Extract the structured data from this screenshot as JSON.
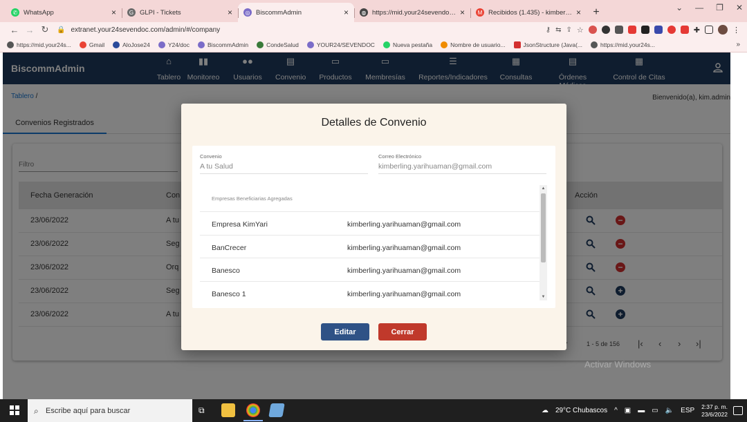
{
  "browser": {
    "tabs": [
      {
        "title": "WhatsApp",
        "color": "#25d366"
      },
      {
        "title": "GLPI - Tickets",
        "color": "#6b6b6b"
      },
      {
        "title": "BiscommAdmin",
        "color": "#7b6cc8"
      },
      {
        "title": "https://mid.your24sevendoc.com",
        "color": "#444444"
      },
      {
        "title": "Recibidos (1.435) - kimberlingyar",
        "color": "#ea4335"
      }
    ],
    "new_tab": "+",
    "url": "extranet.your24sevendoc.com/admin/#/company",
    "bookmarks": [
      {
        "label": "https://mid.your24s...",
        "color": "#555555"
      },
      {
        "label": "Gmail",
        "color": "#ea4335"
      },
      {
        "label": "AloJose24",
        "color": "#2b4a9a"
      },
      {
        "label": "Y24/doc",
        "color": "#7b6cc8"
      },
      {
        "label": "BiscommAdmin",
        "color": "#7b6cc8"
      },
      {
        "label": "CondeSalud",
        "color": "#3a7a3a"
      },
      {
        "label": "YOUR24/SEVENDOC",
        "color": "#7b6cc8"
      },
      {
        "label": "Nueva pestaña",
        "color": "#25d366"
      },
      {
        "label": "Nombre de usuario...",
        "color": "#f08c00"
      },
      {
        "label": "JsonStructure (Java(...",
        "color": "#d32f2f"
      },
      {
        "label": "https://mid.your24s...",
        "color": "#555555"
      }
    ],
    "bookmarks_more": "»"
  },
  "app": {
    "brand": "BiscommAdmin",
    "nav": [
      {
        "label": "Tablero",
        "icon": "home-icon",
        "glyph": "⌂"
      },
      {
        "label": "Monitoreo",
        "icon": "bar-chart-icon",
        "glyph": "▮"
      },
      {
        "label": "Usuarios",
        "icon": "users-icon",
        "glyph": "👥"
      },
      {
        "label": "Convenio",
        "icon": "store-icon",
        "glyph": "▤"
      },
      {
        "label": "Productos",
        "icon": "card-icon",
        "glyph": "▭"
      },
      {
        "label": "Membresías",
        "icon": "card-icon",
        "glyph": "▭"
      },
      {
        "label": "Reportes/Indicadores",
        "icon": "list-icon",
        "glyph": "☰"
      },
      {
        "label": "Consultas",
        "icon": "calendar-icon",
        "glyph": "▦"
      },
      {
        "label": "Órdenes Médicas",
        "icon": "clipboard-icon",
        "glyph": "▤"
      },
      {
        "label": "Control de Citas",
        "icon": "calendar-icon",
        "glyph": "▦"
      }
    ],
    "breadcrumb_link": "Tablero",
    "breadcrumb_sep": " /",
    "welcome": "Bienvenido(a), kim.admin",
    "tab_label": "Convenios Registrados",
    "filter_label": "Filtro",
    "columns": {
      "date": "Fecha Generación",
      "convenio": "Con",
      "action": "Acción"
    },
    "rows": [
      {
        "date": "23/06/2022",
        "convenio": "A tu",
        "action": "delete"
      },
      {
        "date": "23/06/2022",
        "convenio": "Seg",
        "action": "delete"
      },
      {
        "date": "23/06/2022",
        "convenio": "Orq",
        "action": "delete"
      },
      {
        "date": "23/06/2022",
        "convenio": "Seg",
        "action": "add"
      },
      {
        "date": "23/06/2022",
        "convenio": "A tu",
        "action": "add"
      }
    ],
    "pager_range": "1 - 5 de 156",
    "watermark": "Activar Windows"
  },
  "modal": {
    "title": "Detalles de Convenio",
    "convenio_label": "Convenio",
    "convenio_value": "A tu Salud",
    "email_label": "Correo Electrónico",
    "email_value": "kimberling.yarihuaman@gmail.com",
    "list_header": "Empresas Beneficiarias Agregadas",
    "companies": [
      {
        "name": "Empresa KimYari",
        "email": "kimberling.yarihuaman@gmail.com"
      },
      {
        "name": "BanCrecer",
        "email": "kimberling.yarihuaman@gmail.com"
      },
      {
        "name": "Banesco",
        "email": "kimberling.yarihuaman@gmail.com"
      },
      {
        "name": "Banesco 1",
        "email": "kimberling.yarihuaman@gmail.com"
      }
    ],
    "edit_label": "Editar",
    "close_label": "Cerrar"
  },
  "taskbar": {
    "search_placeholder": "Escribe aquí para buscar",
    "weather": "29°C Chubascos",
    "lang": "ESP",
    "time": "2:37 p. m.",
    "date": "23/6/2022"
  }
}
